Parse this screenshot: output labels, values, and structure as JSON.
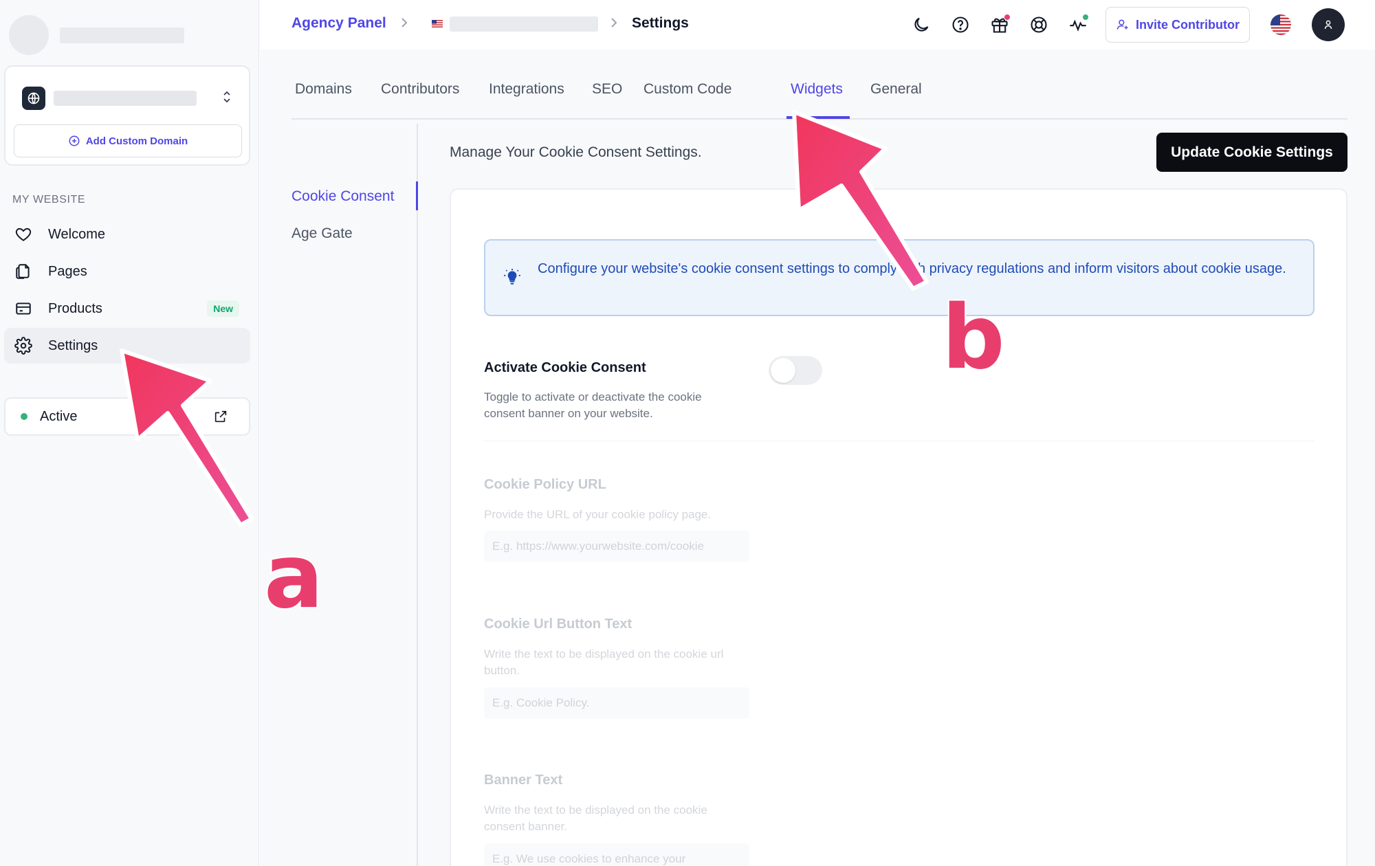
{
  "sidebar": {
    "add_domain_label": "Add Custom Domain",
    "section_label": "MY WEBSITE",
    "items": [
      {
        "label": "Welcome",
        "icon": "heart-icon"
      },
      {
        "label": "Pages",
        "icon": "pages-icon"
      },
      {
        "label": "Products",
        "icon": "card-icon",
        "badge": "New"
      },
      {
        "label": "Settings",
        "icon": "gear-icon",
        "active": true
      }
    ],
    "status_label": "Active"
  },
  "topbar": {
    "breadcrumb_root": "Agency Panel",
    "breadcrumb_current": "Settings",
    "invite_label": "Invite Contributor",
    "icons": [
      "moon-icon",
      "help-icon",
      "gift-icon",
      "support-icon",
      "activity-icon"
    ]
  },
  "tabs": [
    "Domains",
    "Contributors",
    "Integrations",
    "SEO",
    "Custom Code",
    "Widgets",
    "General"
  ],
  "active_tab": "Widgets",
  "subnav": [
    "Cookie Consent",
    "Age Gate"
  ],
  "active_subnav": "Cookie Consent",
  "header": {
    "manage_text": "Manage Your Cookie Consent Settings.",
    "update_button": "Update Cookie Settings"
  },
  "info_text": "Configure your website's cookie consent settings to comply with privacy regulations and inform visitors about cookie usage.",
  "fields": {
    "activate": {
      "title": "Activate Cookie Consent",
      "desc": "Toggle to activate or deactivate the cookie consent banner on your website.",
      "enabled": false
    },
    "policy_url": {
      "title": "Cookie Policy URL",
      "desc": "Provide the URL of your cookie policy page.",
      "placeholder": "E.g. https://www.yourwebsite.com/cookie"
    },
    "url_button_text": {
      "title": "Cookie Url Button Text",
      "desc": "Write the text to be displayed on the cookie url button.",
      "placeholder": "E.g. Cookie Policy."
    },
    "banner_text": {
      "title": "Banner Text",
      "desc": "Write the text to be displayed on the cookie consent banner.",
      "placeholder": "E.g. We use cookies to enhance your"
    }
  },
  "annotations": {
    "a": "a",
    "b": "b"
  },
  "colors": {
    "accent": "#4f46e5",
    "annotation": "#e83e6e",
    "status_green": "#34b27b",
    "new_badge": "#10a572"
  }
}
